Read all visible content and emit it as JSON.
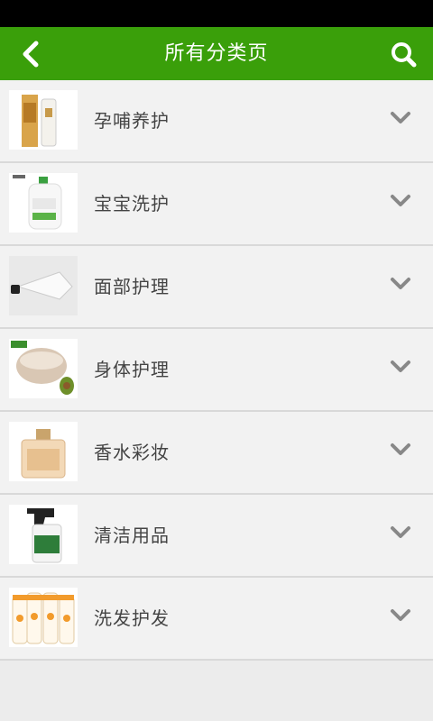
{
  "header": {
    "title": "所有分类页",
    "back_icon": "chevron-left-icon",
    "search_icon": "search-icon",
    "bg_color": "#3a9f0a"
  },
  "categories": [
    {
      "label": "孕哺养护",
      "thumb": "maternity-products-image"
    },
    {
      "label": "宝宝洗护",
      "thumb": "baby-wash-bottle-image"
    },
    {
      "label": "面部护理",
      "thumb": "face-cream-tube-image"
    },
    {
      "label": "身体护理",
      "thumb": "body-scrub-jar-image"
    },
    {
      "label": "香水彩妆",
      "thumb": "perfume-bottle-image"
    },
    {
      "label": "清洁用品",
      "thumb": "spray-cleaner-image"
    },
    {
      "label": "洗发护发",
      "thumb": "shampoo-bottles-image"
    }
  ],
  "row_icon": "chevron-down-icon"
}
